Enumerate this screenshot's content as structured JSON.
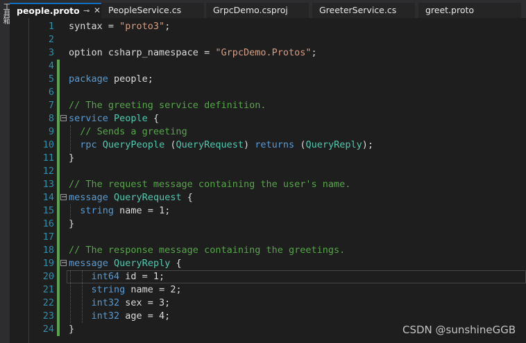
{
  "side_toolbar": {
    "label": "工具箱"
  },
  "tabs": [
    {
      "label": "people.proto",
      "pin": "⊸",
      "close": "✕",
      "active": true
    },
    {
      "label": "PeopleService.cs"
    },
    {
      "label": "GrpcDemo.csproj"
    },
    {
      "label": "GreeterService.cs"
    },
    {
      "label": "greet.proto"
    }
  ],
  "lines": [
    {
      "n": "1",
      "tokens": [
        {
          "t": "syntax = ",
          "c": ""
        },
        {
          "t": "\"proto3\"",
          "c": "str"
        },
        {
          "t": ";",
          "c": ""
        }
      ]
    },
    {
      "n": "2",
      "tokens": []
    },
    {
      "n": "3",
      "tokens": [
        {
          "t": "option csharp_namespace = ",
          "c": ""
        },
        {
          "t": "\"GrpcDemo.Protos\"",
          "c": "str"
        },
        {
          "t": ";",
          "c": ""
        }
      ]
    },
    {
      "n": "4",
      "tokens": []
    },
    {
      "n": "5",
      "tokens": [
        {
          "t": "package",
          "c": "kw"
        },
        {
          "t": " people;",
          "c": ""
        }
      ]
    },
    {
      "n": "6",
      "tokens": []
    },
    {
      "n": "7",
      "tokens": [
        {
          "t": "// The greeting service definition.",
          "c": "cmt"
        }
      ]
    },
    {
      "n": "8",
      "tokens": [
        {
          "t": "service",
          "c": "kw"
        },
        {
          "t": " ",
          "c": ""
        },
        {
          "t": "People",
          "c": "ty"
        },
        {
          "t": " {",
          "c": ""
        }
      ]
    },
    {
      "n": "9",
      "tokens": [
        {
          "t": "  ",
          "c": ""
        },
        {
          "t": "// Sends a greeting",
          "c": "cmt"
        }
      ]
    },
    {
      "n": "10",
      "tokens": [
        {
          "t": "  ",
          "c": ""
        },
        {
          "t": "rpc",
          "c": "kw"
        },
        {
          "t": " ",
          "c": ""
        },
        {
          "t": "QueryPeople",
          "c": "ty"
        },
        {
          "t": " (",
          "c": ""
        },
        {
          "t": "QueryRequest",
          "c": "ty"
        },
        {
          "t": ") ",
          "c": ""
        },
        {
          "t": "returns",
          "c": "kw"
        },
        {
          "t": " (",
          "c": ""
        },
        {
          "t": "QueryReply",
          "c": "ty"
        },
        {
          "t": ");",
          "c": ""
        }
      ]
    },
    {
      "n": "11",
      "tokens": [
        {
          "t": "}",
          "c": ""
        }
      ]
    },
    {
      "n": "12",
      "tokens": []
    },
    {
      "n": "13",
      "tokens": [
        {
          "t": "// The request message containing the user's name.",
          "c": "cmt"
        }
      ]
    },
    {
      "n": "14",
      "tokens": [
        {
          "t": "message",
          "c": "kw"
        },
        {
          "t": " ",
          "c": ""
        },
        {
          "t": "QueryRequest",
          "c": "ty"
        },
        {
          "t": " {",
          "c": ""
        }
      ]
    },
    {
      "n": "15",
      "tokens": [
        {
          "t": "  ",
          "c": ""
        },
        {
          "t": "string",
          "c": "kw"
        },
        {
          "t": " name = 1;",
          "c": ""
        }
      ]
    },
    {
      "n": "16",
      "tokens": [
        {
          "t": "}",
          "c": ""
        }
      ]
    },
    {
      "n": "17",
      "tokens": []
    },
    {
      "n": "18",
      "tokens": [
        {
          "t": "// The response message containing the greetings.",
          "c": "cmt"
        }
      ]
    },
    {
      "n": "19",
      "tokens": [
        {
          "t": "message",
          "c": "kw"
        },
        {
          "t": " ",
          "c": ""
        },
        {
          "t": "QueryReply",
          "c": "ty"
        },
        {
          "t": " {",
          "c": ""
        }
      ]
    },
    {
      "n": "20",
      "tokens": [
        {
          "t": "    ",
          "c": ""
        },
        {
          "t": "int64",
          "c": "kw"
        },
        {
          "t": " id = 1;",
          "c": ""
        }
      ]
    },
    {
      "n": "21",
      "tokens": [
        {
          "t": "    ",
          "c": ""
        },
        {
          "t": "string",
          "c": "kw"
        },
        {
          "t": " name = 2;",
          "c": ""
        }
      ]
    },
    {
      "n": "22",
      "tokens": [
        {
          "t": "    ",
          "c": ""
        },
        {
          "t": "int32",
          "c": "kw"
        },
        {
          "t": " sex = 3;",
          "c": ""
        }
      ]
    },
    {
      "n": "23",
      "tokens": [
        {
          "t": "    ",
          "c": ""
        },
        {
          "t": "int32",
          "c": "kw"
        },
        {
          "t": " age = 4;",
          "c": ""
        }
      ]
    },
    {
      "n": "24",
      "tokens": [
        {
          "t": "}",
          "c": ""
        }
      ]
    }
  ],
  "fold_markers": {
    "collapse_symbol": "−"
  },
  "watermark": "CSDN @sunshineGGB",
  "colors": {
    "keyword": "#569cd6",
    "string": "#d69d85",
    "comment": "#57a64a",
    "type": "#4ec9b0",
    "line_number": "#2b91af",
    "change_bar": "#57a64a"
  }
}
